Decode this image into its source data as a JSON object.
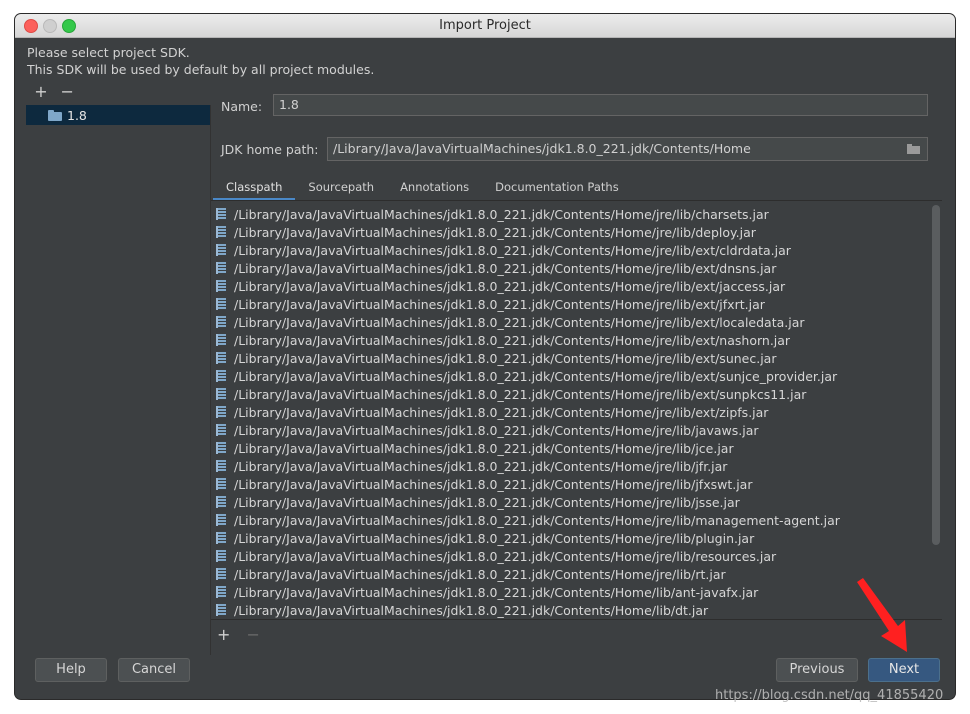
{
  "window": {
    "title": "Import Project"
  },
  "description": {
    "line1": "Please select project SDK.",
    "line2": "This SDK will be used by default by all project modules."
  },
  "sdk_list": {
    "toolbar": {
      "add": "+",
      "remove": "−"
    },
    "items": [
      {
        "label": "1.8",
        "selected": true
      }
    ]
  },
  "form": {
    "name_label": "Name:",
    "name_value": "1.8",
    "jdk_label": "JDK home path:",
    "jdk_value": "/Library/Java/JavaVirtualMachines/jdk1.8.0_221.jdk/Contents/Home"
  },
  "tabs": [
    {
      "label": "Classpath",
      "active": true
    },
    {
      "label": "Sourcepath",
      "active": false
    },
    {
      "label": "Annotations",
      "active": false
    },
    {
      "label": "Documentation Paths",
      "active": false
    }
  ],
  "classpath": [
    "/Library/Java/JavaVirtualMachines/jdk1.8.0_221.jdk/Contents/Home/jre/lib/charsets.jar",
    "/Library/Java/JavaVirtualMachines/jdk1.8.0_221.jdk/Contents/Home/jre/lib/deploy.jar",
    "/Library/Java/JavaVirtualMachines/jdk1.8.0_221.jdk/Contents/Home/jre/lib/ext/cldrdata.jar",
    "/Library/Java/JavaVirtualMachines/jdk1.8.0_221.jdk/Contents/Home/jre/lib/ext/dnsns.jar",
    "/Library/Java/JavaVirtualMachines/jdk1.8.0_221.jdk/Contents/Home/jre/lib/ext/jaccess.jar",
    "/Library/Java/JavaVirtualMachines/jdk1.8.0_221.jdk/Contents/Home/jre/lib/ext/jfxrt.jar",
    "/Library/Java/JavaVirtualMachines/jdk1.8.0_221.jdk/Contents/Home/jre/lib/ext/localedata.jar",
    "/Library/Java/JavaVirtualMachines/jdk1.8.0_221.jdk/Contents/Home/jre/lib/ext/nashorn.jar",
    "/Library/Java/JavaVirtualMachines/jdk1.8.0_221.jdk/Contents/Home/jre/lib/ext/sunec.jar",
    "/Library/Java/JavaVirtualMachines/jdk1.8.0_221.jdk/Contents/Home/jre/lib/ext/sunjce_provider.jar",
    "/Library/Java/JavaVirtualMachines/jdk1.8.0_221.jdk/Contents/Home/jre/lib/ext/sunpkcs11.jar",
    "/Library/Java/JavaVirtualMachines/jdk1.8.0_221.jdk/Contents/Home/jre/lib/ext/zipfs.jar",
    "/Library/Java/JavaVirtualMachines/jdk1.8.0_221.jdk/Contents/Home/jre/lib/javaws.jar",
    "/Library/Java/JavaVirtualMachines/jdk1.8.0_221.jdk/Contents/Home/jre/lib/jce.jar",
    "/Library/Java/JavaVirtualMachines/jdk1.8.0_221.jdk/Contents/Home/jre/lib/jfr.jar",
    "/Library/Java/JavaVirtualMachines/jdk1.8.0_221.jdk/Contents/Home/jre/lib/jfxswt.jar",
    "/Library/Java/JavaVirtualMachines/jdk1.8.0_221.jdk/Contents/Home/jre/lib/jsse.jar",
    "/Library/Java/JavaVirtualMachines/jdk1.8.0_221.jdk/Contents/Home/jre/lib/management-agent.jar",
    "/Library/Java/JavaVirtualMachines/jdk1.8.0_221.jdk/Contents/Home/jre/lib/plugin.jar",
    "/Library/Java/JavaVirtualMachines/jdk1.8.0_221.jdk/Contents/Home/jre/lib/resources.jar",
    "/Library/Java/JavaVirtualMachines/jdk1.8.0_221.jdk/Contents/Home/jre/lib/rt.jar",
    "/Library/Java/JavaVirtualMachines/jdk1.8.0_221.jdk/Contents/Home/lib/ant-javafx.jar",
    "/Library/Java/JavaVirtualMachines/jdk1.8.0_221.jdk/Contents/Home/lib/dt.jar"
  ],
  "list_toolbar": {
    "add": "+",
    "remove": "−"
  },
  "buttons": {
    "help": "Help",
    "cancel": "Cancel",
    "previous": "Previous",
    "next": "Next"
  },
  "watermark": "https://blog.csdn.net/qq_41855420",
  "colors": {
    "accent": "#4a88c7",
    "next_button": "#365880",
    "selection": "#0d293e",
    "annotation_arrow": "#ff2020"
  }
}
